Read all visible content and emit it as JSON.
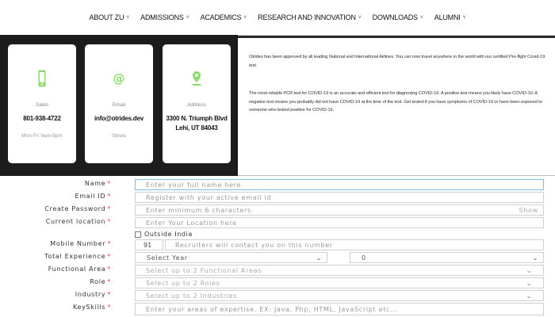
{
  "nav": [
    {
      "label": "ABOUT ZU"
    },
    {
      "label": "ADMISSIONS"
    },
    {
      "label": "ACADEMICS"
    },
    {
      "label": "RESEARCH AND INNOVATION"
    },
    {
      "label": "DOWNLOADS"
    },
    {
      "label": "ALUMNI"
    }
  ],
  "contact": {
    "sales": {
      "label": "Sales",
      "value": "801-938-4722",
      "sub": "Mon-Fri 9am-5pm"
    },
    "email": {
      "label": "Email",
      "value": "info@otrides.dev",
      "sub": "Stevie"
    },
    "address": {
      "label": "Address",
      "line1": "3300 N. Triumph Blvd",
      "line2": "Lehi, UT 84043"
    }
  },
  "info": {
    "p1": "Otrides has been approved by all leading National and International Airlines. You can now travel anywhere in the world with our certified Pre-flight Covid-19 test.",
    "p2": "The most reliable PCR test for COVID-19 is an accurate and efficient tool for diagnosing COVID-19. A positive test means you likely have COVID-19. A negative test means you probably did not have COVID-19 at the time of the test. Get tested if you have symptoms of COVID-19 or have been exposed to someone who tested positive for COVID-19."
  },
  "form": {
    "name": {
      "label": "Name",
      "placeholder": "Enter your full name here"
    },
    "email": {
      "label": "Email ID",
      "placeholder": "Register with your active email id"
    },
    "password": {
      "label": "Create Password",
      "placeholder": "Enter minimum 6 characters",
      "toggle": "Show"
    },
    "location": {
      "label": "Current location",
      "placeholder": "Enter Your Location here"
    },
    "outside": {
      "label": "Outside India"
    },
    "mobile": {
      "label": "Mobile Number",
      "code": "91",
      "placeholder": "Recruiters will contact you on this number"
    },
    "experience": {
      "label": "Total Experience",
      "year": "Select Year",
      "month": "0"
    },
    "functional": {
      "label": "Functional Area",
      "placeholder": "Select up to 2 Functional Areas"
    },
    "role": {
      "label": "Role",
      "placeholder": "Select up to 2 Roles"
    },
    "industry": {
      "label": "Industry",
      "placeholder": "Select up to 2 Industries"
    },
    "skills": {
      "label": "KeySkills",
      "placeholder": "Enter your areas of expertise. EX: Java, Php, HTML, JavaScript etc..."
    },
    "required_mark": "*"
  },
  "colors": {
    "accent": "#7cc0e8",
    "icon": "#8bdc6a",
    "required": "#e04040",
    "panel": "#1c1c1c"
  }
}
